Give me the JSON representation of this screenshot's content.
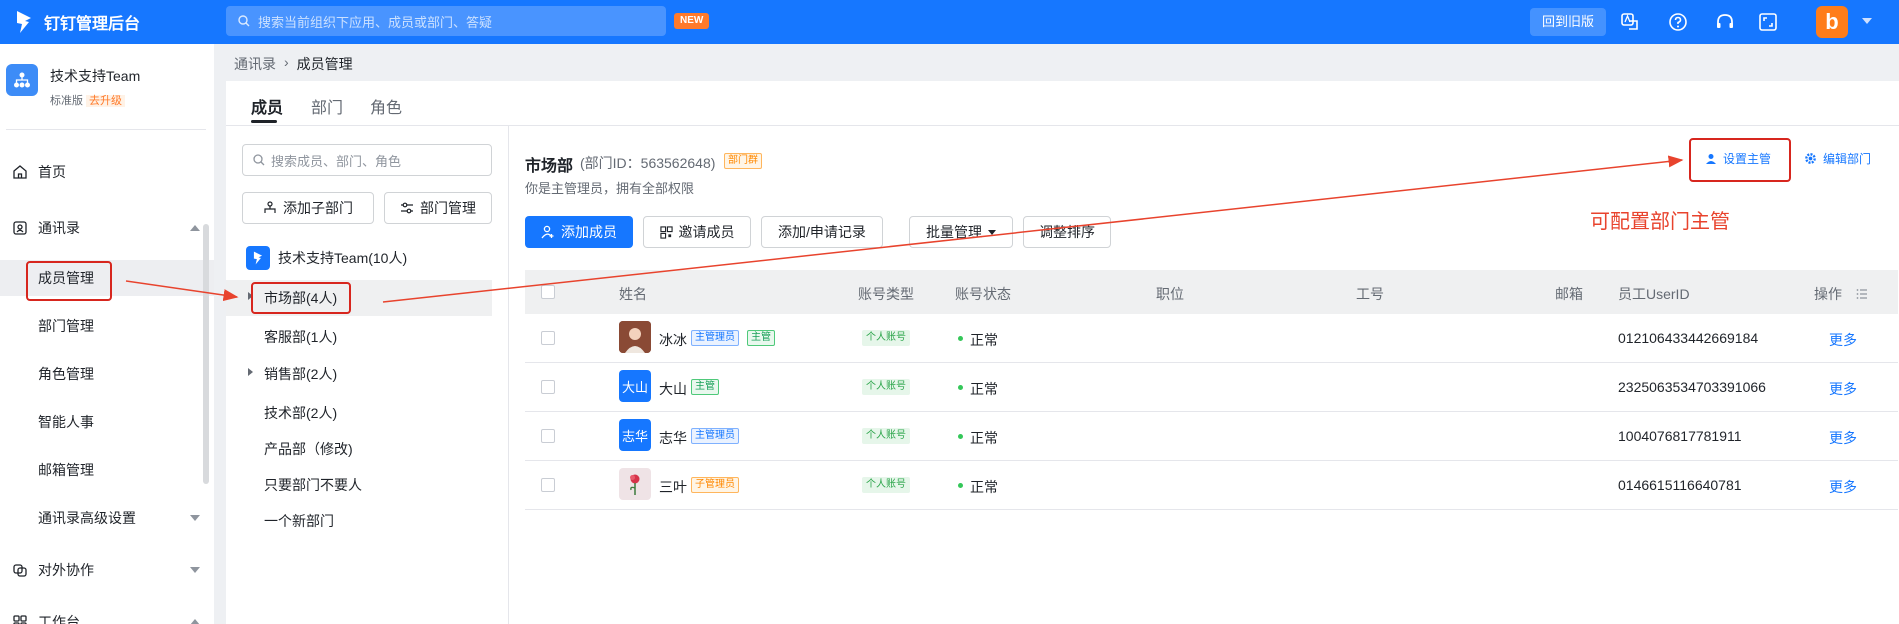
{
  "topbar": {
    "title": "钉钉管理后台",
    "search_placeholder": "搜索当前组织下应用、成员或部门、答疑",
    "new_badge": "NEW",
    "old_version_label": "回到旧版",
    "avatar_letter": "b"
  },
  "org": {
    "name": "技术支持Team",
    "edition": "标准版",
    "upgrade": "去升级"
  },
  "nav": {
    "home": "首页",
    "contacts": "通讯录",
    "sub": [
      "成员管理",
      "部门管理",
      "角色管理",
      "智能人事",
      "邮箱管理",
      "通讯录高级设置"
    ],
    "external": "对外协作",
    "workbench": "工作台"
  },
  "breadcrumb": {
    "parent": "通讯录",
    "current": "成员管理"
  },
  "tabs": [
    "成员",
    "部门",
    "角色"
  ],
  "tree": {
    "search_placeholder": "搜索成员、部门、角色",
    "add_sub_dept": "添加子部门",
    "dept_manage": "部门管理",
    "root": "技术支持Team(10人)",
    "items": [
      "市场部(4人)",
      "客服部(1人)",
      "销售部(2人)",
      "技术部(2人)",
      "产品部（修改)",
      "只要部门不要人",
      "一个新部门"
    ]
  },
  "dept": {
    "name": "市场部",
    "id_text": "(部门ID：563562648)",
    "tag": "部门群",
    "subtitle": "你是主管理员，拥有全部权限",
    "set_manager": "设置主管",
    "edit_dept": "编辑部门"
  },
  "actions": {
    "add_member": "添加成员",
    "invite": "邀请成员",
    "records": "添加/申请记录",
    "batch": "批量管理",
    "sort": "调整排序"
  },
  "annotation": {
    "text": "可配置部门主管"
  },
  "table": {
    "headers": [
      "姓名",
      "账号类型",
      "账号状态",
      "职位",
      "工号",
      "邮箱",
      "员工UserID",
      "操作"
    ],
    "rows": [
      {
        "name": "冰冰",
        "avatar_text": "",
        "badges": [
          "主管理员",
          "主管"
        ],
        "account_type": "个人账号",
        "status": "正常",
        "userid": "012106433442669184",
        "action": "更多"
      },
      {
        "name": "大山",
        "avatar_text": "大山",
        "badges": [
          "主管"
        ],
        "account_type": "个人账号",
        "status": "正常",
        "userid": "2325063534703391066",
        "action": "更多"
      },
      {
        "name": "志华",
        "avatar_text": "志华",
        "badges": [
          "主管理员"
        ],
        "account_type": "个人账号",
        "status": "正常",
        "userid": "1004076817781911",
        "action": "更多"
      },
      {
        "name": "三叶",
        "avatar_text": "",
        "badges": [
          "子管理员"
        ],
        "account_type": "个人账号",
        "status": "正常",
        "userid": "0146615116640781",
        "action": "更多"
      }
    ]
  },
  "colors": {
    "brand": "#1677ff",
    "annotation": "#e8432d",
    "active_bg": "#edeef1"
  }
}
